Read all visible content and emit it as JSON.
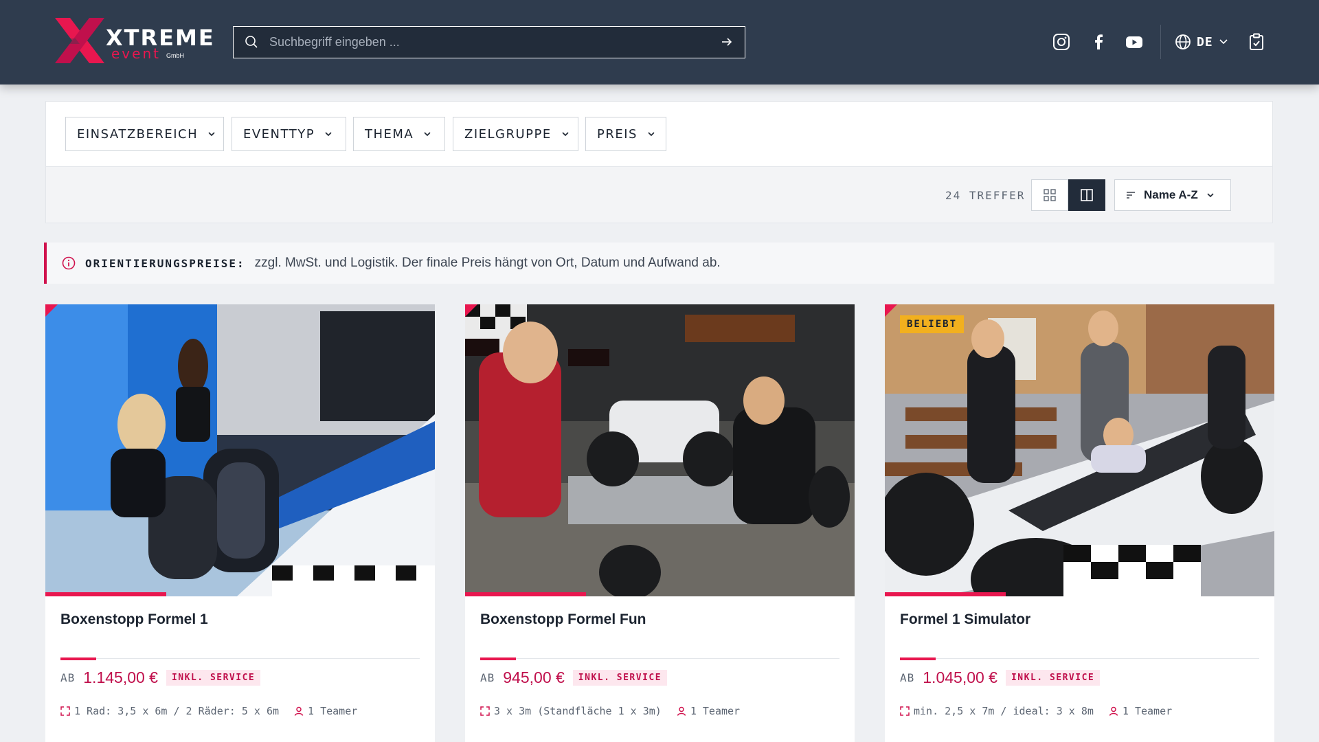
{
  "brand": {
    "word": "XTREME",
    "sub": "event",
    "suffix": "GmbH"
  },
  "search": {
    "placeholder": "Suchbegriff eingeben ..."
  },
  "header": {
    "language": "DE"
  },
  "filters": [
    {
      "label": "EINSATZBEREICH"
    },
    {
      "label": "EVENTTYP"
    },
    {
      "label": "THEMA"
    },
    {
      "label": "ZIELGRUPPE"
    },
    {
      "label": "PREIS"
    }
  ],
  "results": {
    "count_label": "24 TREFFER",
    "sort_label": "Name A-Z"
  },
  "info": {
    "label": "ORIENTIERUNGSPREISE:",
    "text": "zzgl. MwSt. und Logistik. Der finale Preis hängt von Ort, Datum und Aufwand ab."
  },
  "products": [
    {
      "title": "Boxenstopp Formel 1",
      "prefix": "AB",
      "price": "1.145,00 €",
      "service": "INKL. SERVICE",
      "size": "1 Rad: 3,5 x 6m / 2 Räder: 5 x 6m",
      "teamer": "1 Teamer"
    },
    {
      "title": "Boxenstopp Formel Fun",
      "prefix": "AB",
      "price": "945,00 €",
      "service": "INKL. SERVICE",
      "size": "3 x 3m (Standfläche 1 x 3m)",
      "teamer": "1 Teamer"
    },
    {
      "title": "Formel 1 Simulator",
      "badge": "BELIEBT",
      "prefix": "AB",
      "price": "1.045,00 €",
      "service": "INKL. SERVICE",
      "size": "min. 2,5 x 7m / ideal: 3 x 8m",
      "teamer": "1 Teamer"
    }
  ],
  "colors": {
    "accent": "#e8174f",
    "header_bg": "#2f3c4e",
    "badge": "#f2b01e"
  }
}
